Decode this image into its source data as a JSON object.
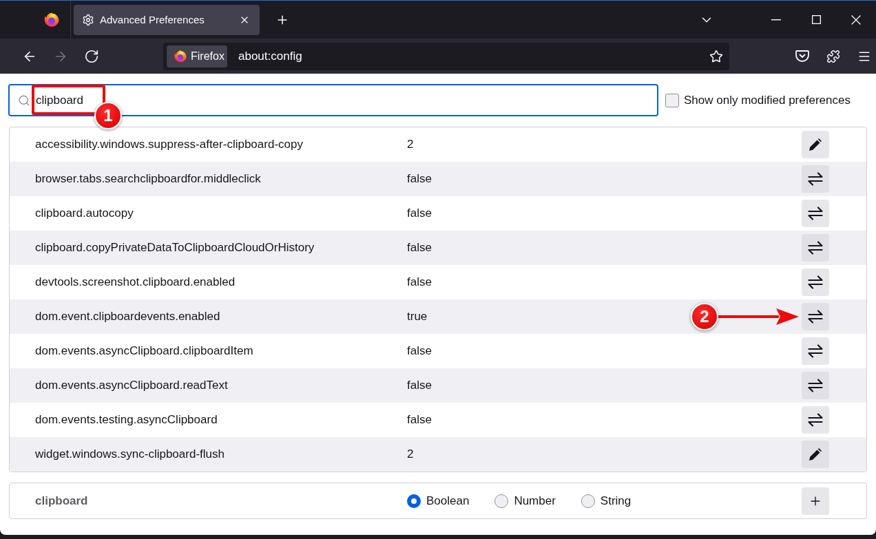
{
  "tab_strip": {
    "tabs": [
      {
        "title": "Advanced Preferences",
        "selected": true
      }
    ]
  },
  "toolbar": {
    "nav_buttons": [
      {
        "kind": "back",
        "disabled": false
      },
      {
        "kind": "forward",
        "disabled": true
      },
      {
        "kind": "reload",
        "disabled": false
      }
    ],
    "address_bar": {
      "identity": "Firefox",
      "url": "about:config"
    }
  },
  "search": {
    "value": "clipboard",
    "annotation": "1"
  },
  "modified_only": {
    "label": "Show only modified preferences",
    "checked": false
  },
  "preferences": [
    {
      "name": "accessibility.windows.suppress-after-clipboard-copy",
      "value": "2",
      "kind": "number"
    },
    {
      "name": "browser.tabs.searchclipboardfor.middleclick",
      "value": "false",
      "kind": "boolean"
    },
    {
      "name": "clipboard.autocopy",
      "value": "false",
      "kind": "boolean"
    },
    {
      "name": "clipboard.copyPrivateDataToClipboardCloudOrHistory",
      "value": "false",
      "kind": "boolean"
    },
    {
      "name": "devtools.screenshot.clipboard.enabled",
      "value": "false",
      "kind": "boolean"
    },
    {
      "name": "dom.event.clipboardevents.enabled",
      "value": "true",
      "kind": "boolean",
      "annotation": "2"
    },
    {
      "name": "dom.events.asyncClipboard.clipboardItem",
      "value": "false",
      "kind": "boolean"
    },
    {
      "name": "dom.events.asyncClipboard.readText",
      "value": "false",
      "kind": "boolean"
    },
    {
      "name": "dom.events.testing.asyncClipboard",
      "value": "false",
      "kind": "boolean"
    },
    {
      "name": "widget.windows.sync-clipboard-flush",
      "value": "2",
      "kind": "number"
    }
  ],
  "new_preference": {
    "name": "clipboard",
    "types": [
      {
        "label": "Boolean",
        "selected": true
      },
      {
        "label": "Number",
        "selected": false
      },
      {
        "label": "String",
        "selected": false
      }
    ]
  }
}
